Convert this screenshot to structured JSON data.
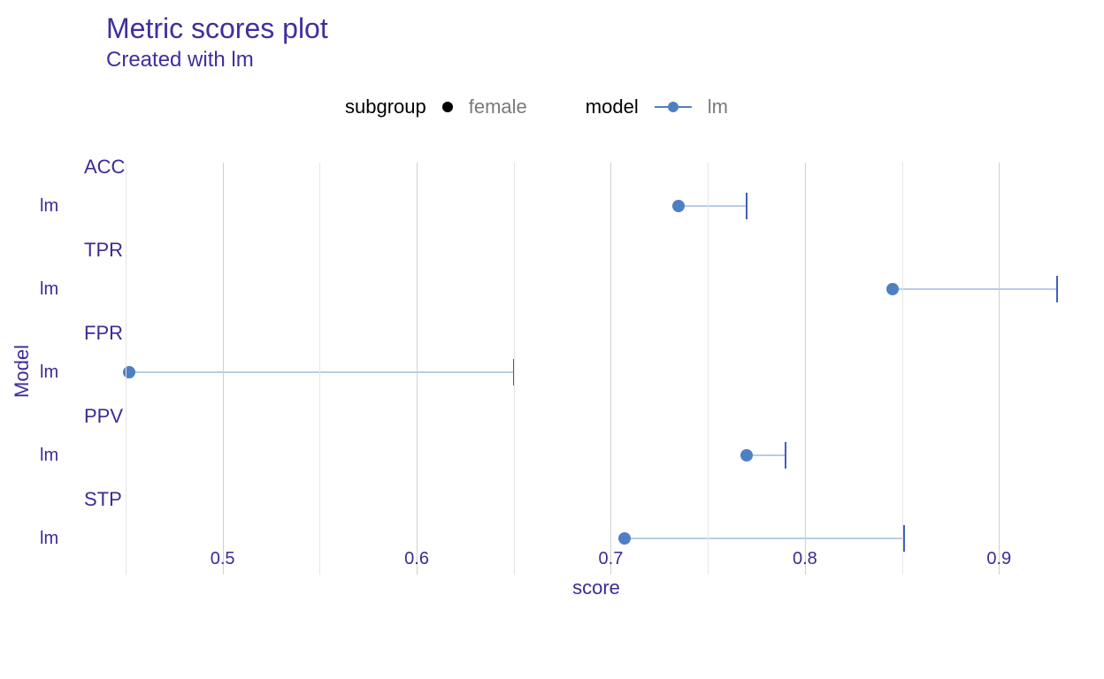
{
  "title": "Metric scores plot",
  "subtitle": "Created with lm",
  "legend": {
    "subgroup_label": "subgroup",
    "subgroup_value": "female",
    "model_label": "model",
    "model_value": "lm"
  },
  "ylabel": "Model",
  "xlabel": "score",
  "xticks": [
    "0.5",
    "0.6",
    "0.7",
    "0.8",
    "0.9"
  ],
  "rows": [
    {
      "metric": "ACC",
      "model": "lm"
    },
    {
      "metric": "TPR",
      "model": "lm"
    },
    {
      "metric": "FPR",
      "model": "lm"
    },
    {
      "metric": "PPV",
      "model": "lm"
    },
    {
      "metric": "STP",
      "model": "lm"
    }
  ],
  "chart_data": {
    "type": "bar",
    "categories": [
      "ACC",
      "TPR",
      "FPR",
      "PPV",
      "STP"
    ],
    "series": [
      {
        "name": "female (point)",
        "values": [
          0.735,
          0.845,
          0.452,
          0.77,
          0.707
        ]
      },
      {
        "name": "endbar",
        "values": [
          0.77,
          0.93,
          0.65,
          0.79,
          0.851
        ]
      }
    ],
    "xlabel": "score",
    "ylabel": "Model",
    "title": "Metric scores plot",
    "subtitle": "Created with lm",
    "xlim": [
      0.44,
      0.945
    ],
    "x_major_ticks": [
      0.5,
      0.6,
      0.7,
      0.8,
      0.9
    ],
    "x_minor_ticks": [
      0.45,
      0.55,
      0.65,
      0.75,
      0.85
    ],
    "model": "lm",
    "subgroup": "female"
  }
}
